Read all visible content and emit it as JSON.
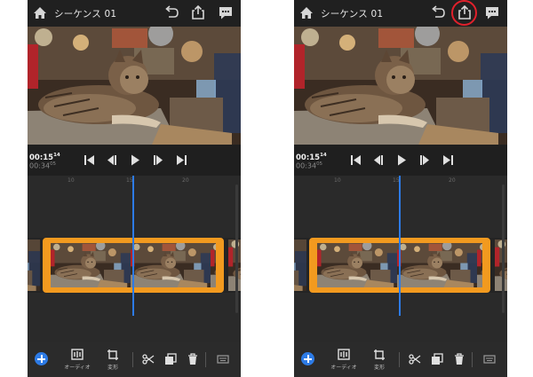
{
  "sequence_title": "シーケンス 01",
  "timecode": {
    "current_main": "00:15",
    "current_frame": "14",
    "total_main": "00:34",
    "total_frame": "05"
  },
  "ruler_labels": [
    "10",
    "15",
    "20"
  ],
  "toolbar": {
    "audio_label": "オーディオ",
    "transform_label": "変形"
  },
  "colors": {
    "clip_selection": "#f29a1f",
    "playhead": "#2d7be6",
    "highlight_ring": "#e0202b"
  },
  "icons": [
    "home-icon",
    "undo-icon",
    "share-icon",
    "comment-icon",
    "go-to-start-icon",
    "step-back-icon",
    "play-icon",
    "step-forward-icon",
    "go-to-end-icon",
    "add-icon",
    "audio-icon",
    "transform-icon",
    "scissors-icon",
    "duplicate-icon",
    "trash-icon",
    "keyboard-icon"
  ]
}
